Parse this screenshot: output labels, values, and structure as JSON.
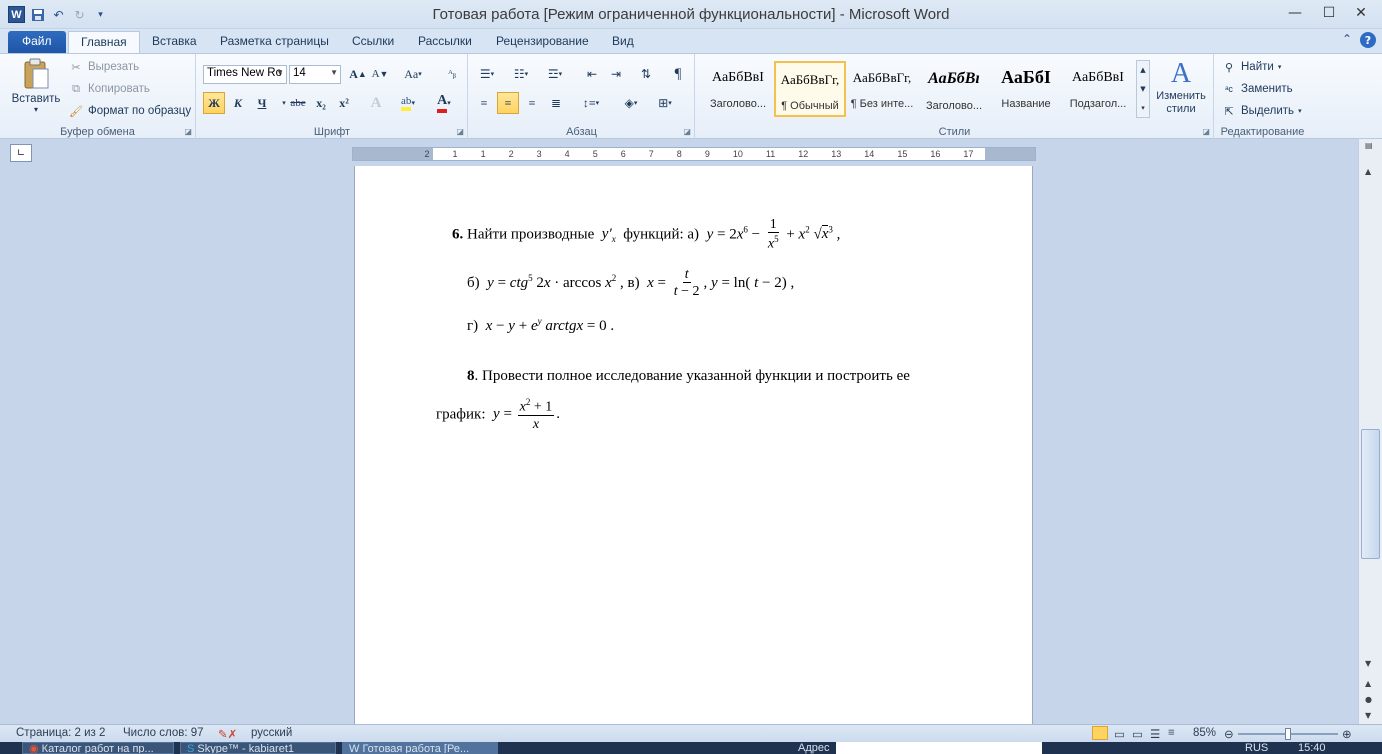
{
  "window": {
    "title": "Готовая работа [Режим ограниченной функциональности]  -  Microsoft Word"
  },
  "quick_access": [
    "word-icon",
    "save-icon",
    "undo-icon",
    "redo-icon",
    "customize-icon"
  ],
  "tabs": [
    "Файл",
    "Главная",
    "Вставка",
    "Разметка страницы",
    "Ссылки",
    "Рассылки",
    "Рецензирование",
    "Вид"
  ],
  "clipboard": {
    "paste": "Вставить",
    "cut": "Вырезать",
    "copy": "Копировать",
    "format_painter": "Формат по образцу",
    "label": "Буфер обмена"
  },
  "font": {
    "name": "Times New Ro",
    "size": "14",
    "label": "Шрифт",
    "bold": "Ж",
    "italic": "К",
    "underline": "Ч",
    "strike": "abe",
    "subscript": "x₂",
    "superscript": "x²",
    "grow": "A",
    "shrink": "A",
    "case": "Aa"
  },
  "paragraph": {
    "label": "Абзац"
  },
  "styles": {
    "label": "Стили",
    "items": [
      {
        "sample": "АаБбВвІ",
        "name": "Заголово..."
      },
      {
        "sample": "АаБбВвГг,",
        "name": "¶ Обычный"
      },
      {
        "sample": "АаБбВвГг,",
        "name": "¶ Без инте..."
      },
      {
        "sample": "АаБбВı",
        "name": "Заголово..."
      },
      {
        "sample": "АаБбІ",
        "name": "Название"
      },
      {
        "sample": "АаБбВвІ",
        "name": "Подзагол..."
      }
    ],
    "change": "Изменить стили"
  },
  "editing": {
    "label": "Редактирование",
    "find": "Найти",
    "replace": "Заменить",
    "select": "Выделить"
  },
  "ruler": [
    "2",
    "1",
    "1",
    "2",
    "3",
    "4",
    "5",
    "6",
    "7",
    "8",
    "9",
    "10",
    "11",
    "12",
    "13",
    "14",
    "15",
    "16",
    "17"
  ],
  "document": {
    "task6": {
      "num": "6.",
      "text": "Найти производные",
      "text2": "функций: а)",
      "b_label": "б)",
      "c_label": "в)",
      "d_label": "г)"
    },
    "task8": {
      "num": "8",
      "text": ". Провести полное исследование указанной функции и построить ее",
      "text2": "график:"
    }
  },
  "status": {
    "page": "Страница: 2 из 2",
    "words": "Число слов: 97",
    "lang": "русский",
    "zoom": "85%",
    "zoom_fraction": 0.5
  },
  "taskbar": {
    "items": [
      "Каталог работ на пр...",
      "Skype™ - kabiaret1",
      "Готовая работа [Ре..."
    ],
    "address_label": "Адрес",
    "lang": "RUS",
    "time": "15:40"
  }
}
